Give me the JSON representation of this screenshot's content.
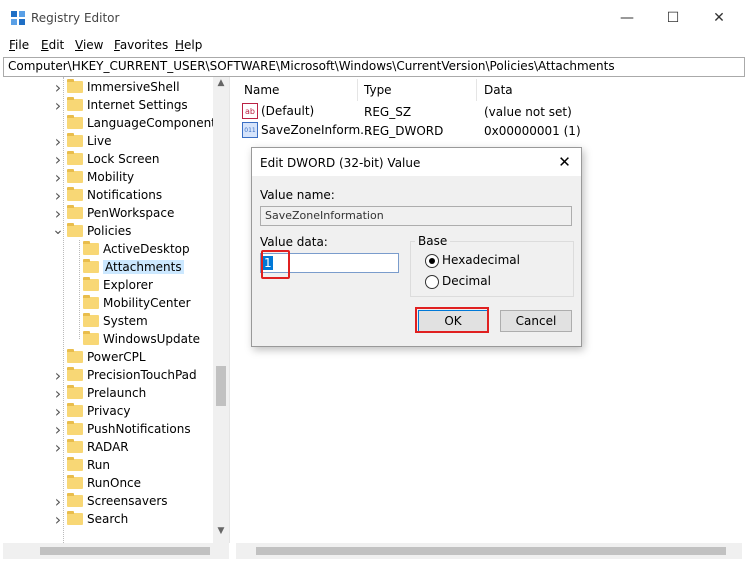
{
  "window": {
    "title": "Registry Editor",
    "controls": {
      "minimize": "—",
      "maximize": "☐",
      "close": "✕"
    }
  },
  "menu": [
    {
      "label": "File",
      "accel": "F",
      "rest": "ile"
    },
    {
      "label": "Edit",
      "accel": "E",
      "rest": "dit"
    },
    {
      "label": "View",
      "accel": "V",
      "rest": "iew"
    },
    {
      "label": "Favorites",
      "accel": "F",
      "rest": "avorites",
      "prefix": ""
    },
    {
      "label": "Help",
      "accel": "H",
      "rest": "elp"
    }
  ],
  "address": "Computer\\HKEY_CURRENT_USER\\SOFTWARE\\Microsoft\\Windows\\CurrentVersion\\Policies\\Attachments",
  "tree": [
    {
      "label": "ImmersiveShell",
      "level": 0,
      "expander": ">"
    },
    {
      "label": "Internet Settings",
      "level": 0,
      "expander": ">"
    },
    {
      "label": "LanguageComponentsI",
      "level": 0,
      "expander": ""
    },
    {
      "label": "Live",
      "level": 0,
      "expander": ">"
    },
    {
      "label": "Lock Screen",
      "level": 0,
      "expander": ">"
    },
    {
      "label": "Mobility",
      "level": 0,
      "expander": ">"
    },
    {
      "label": "Notifications",
      "level": 0,
      "expander": ">"
    },
    {
      "label": "PenWorkspace",
      "level": 0,
      "expander": ">"
    },
    {
      "label": "Policies",
      "level": 0,
      "expander": "v"
    },
    {
      "label": "ActiveDesktop",
      "level": 1,
      "expander": ""
    },
    {
      "label": "Attachments",
      "level": 1,
      "expander": "",
      "selected": true
    },
    {
      "label": "Explorer",
      "level": 1,
      "expander": ""
    },
    {
      "label": "MobilityCenter",
      "level": 1,
      "expander": ""
    },
    {
      "label": "System",
      "level": 1,
      "expander": ""
    },
    {
      "label": "WindowsUpdate",
      "level": 1,
      "expander": ""
    },
    {
      "label": "PowerCPL",
      "level": 0,
      "expander": ""
    },
    {
      "label": "PrecisionTouchPad",
      "level": 0,
      "expander": ">"
    },
    {
      "label": "Prelaunch",
      "level": 0,
      "expander": ">"
    },
    {
      "label": "Privacy",
      "level": 0,
      "expander": ">"
    },
    {
      "label": "PushNotifications",
      "level": 0,
      "expander": ">"
    },
    {
      "label": "RADAR",
      "level": 0,
      "expander": ">"
    },
    {
      "label": "Run",
      "level": 0,
      "expander": ""
    },
    {
      "label": "RunOnce",
      "level": 0,
      "expander": ""
    },
    {
      "label": "Screensavers",
      "level": 0,
      "expander": ">"
    },
    {
      "label": "Search",
      "level": 0,
      "expander": ">"
    }
  ],
  "extra_tree_top": {
    "label": "ImmersiveShell"
  },
  "list": {
    "headers": {
      "name": "Name",
      "type": "Type",
      "data": "Data"
    },
    "rows": [
      {
        "icon": "ab",
        "name": "(Default)",
        "type": "REG_SZ",
        "data": "(value not set)"
      },
      {
        "icon": "dword",
        "name": "SaveZoneInform...",
        "type": "REG_DWORD",
        "data": "0x00000001 (1)"
      }
    ]
  },
  "dialog": {
    "title": "Edit DWORD (32-bit) Value",
    "value_name_label": "Value name:",
    "value_name": "SaveZoneInformation",
    "value_data_label": "Value data:",
    "value_data": "1",
    "base_label": "Base",
    "hex_label": "Hexadecimal",
    "dec_label": "Decimal",
    "base_selected": "Hexadecimal",
    "ok_label": "OK",
    "cancel_label": "Cancel",
    "highlight_color": "#e02020"
  }
}
